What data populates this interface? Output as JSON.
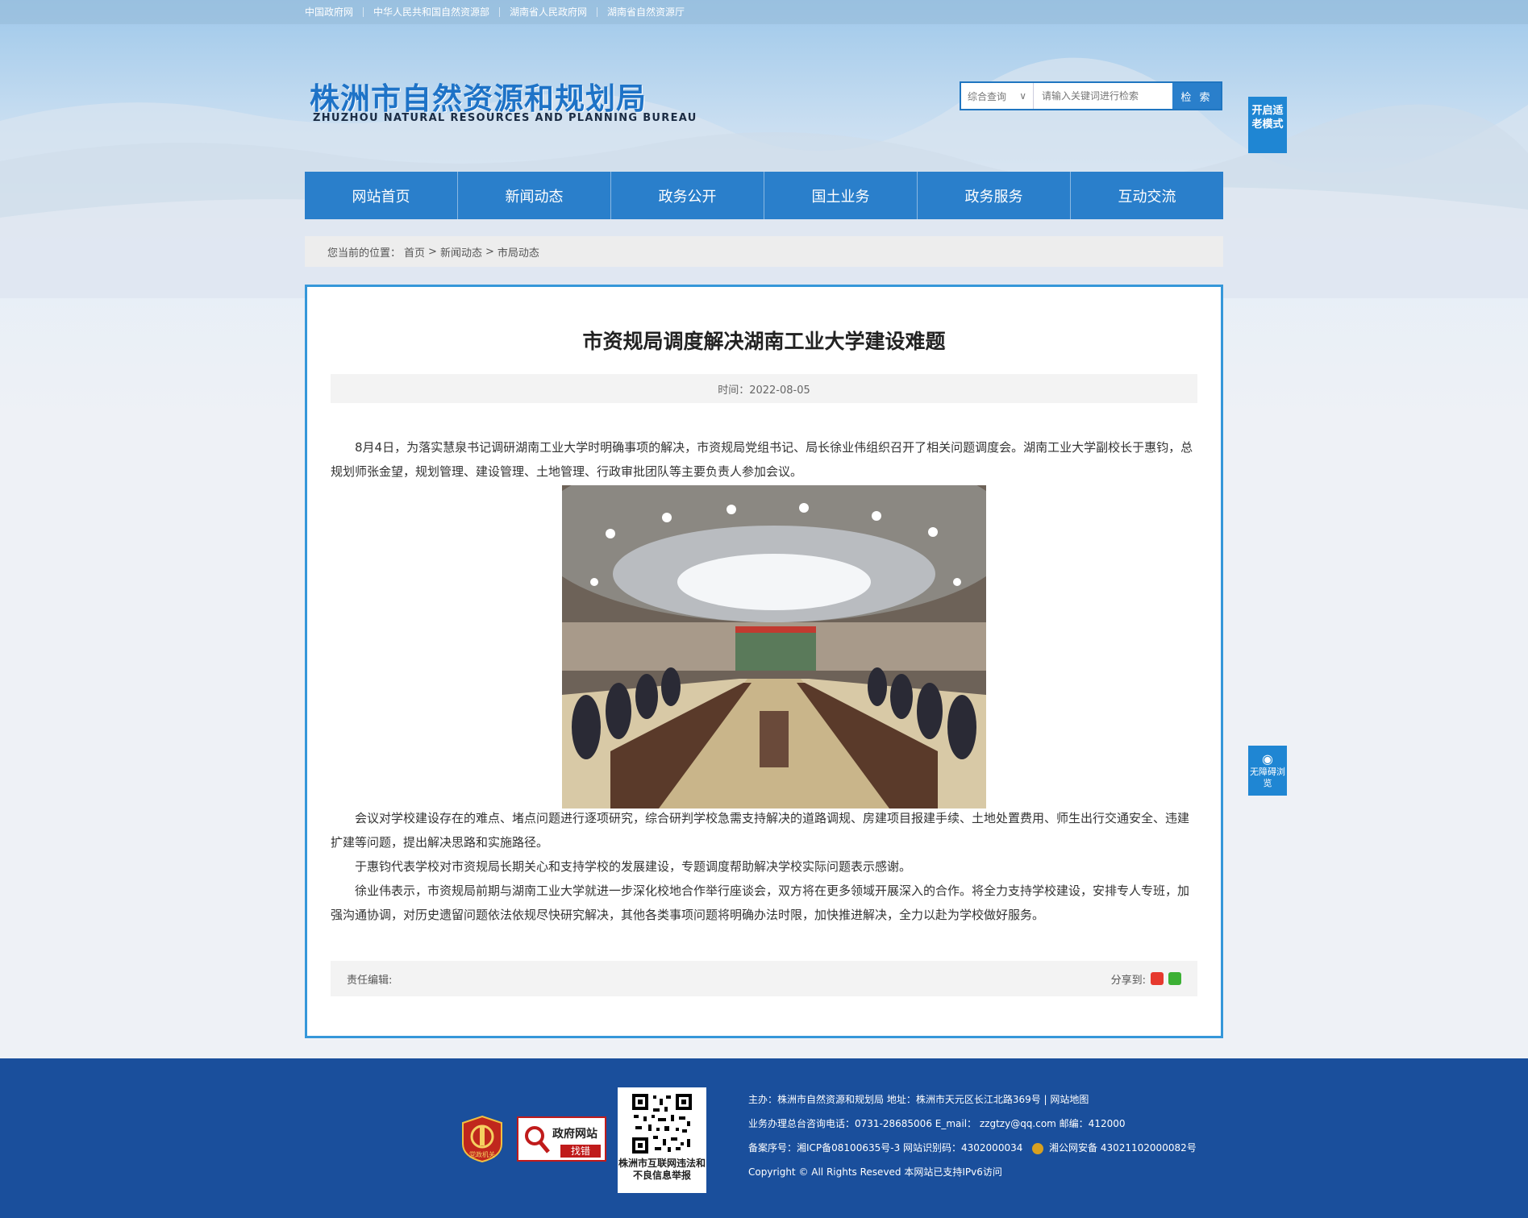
{
  "top_links": [
    "中国政府网",
    "中华人民共和国自然资源部",
    "湖南省人民政府网",
    "湖南省自然资源厅"
  ],
  "header": {
    "logo_cn": "株洲市自然资源和规划局",
    "logo_en": "ZHUZHOU NATURAL RESOURCES AND PLANNING BUREAU"
  },
  "search": {
    "scope": "综合查询",
    "placeholder": "请输入关键词进行检索",
    "button": "检 索"
  },
  "side": {
    "elder_mode": "开启适老模式",
    "accessibility": "无障碍浏览"
  },
  "nav": [
    "网站首页",
    "新闻动态",
    "政务公开",
    "国土业务",
    "政务服务",
    "互动交流"
  ],
  "breadcrumb": {
    "label": "您当前的位置：",
    "items": [
      "首页",
      ">",
      "新闻动态",
      ">",
      "市局动态"
    ]
  },
  "article": {
    "title": "市资规局调度解决湖南工业大学建设难题",
    "date": "时间：2022-08-05",
    "paragraphs": [
      "8月4日，为落实慧泉书记调研湖南工业大学时明确事项的解决，市资规局党组书记、局长徐业伟组织召开了相关问题调度会。湖南工业大学副校长于惠钧，总规划师张金望，规划管理、建设管理、土地管理、行政审批团队等主要负责人参加会议。",
      "会议对学校建设存在的难点、堵点问题进行逐项研究，综合研判学校急需支持解决的道路调规、房建项目报建手续、土地处置费用、师生出行交通安全、违建扩建等问题，提出解决思路和实施路径。",
      "于惠钧代表学校对市资规局长期关心和支持学校的发展建设，专题调度帮助解决学校实际问题表示感谢。",
      "徐业伟表示，市资规局前期与湖南工业大学就进一步深化校地合作举行座谈会，双方将在更多领域开展深入的合作。将全力支持学校建设，安排专人专班，加强沟通协调，对历史遗留问题依法依规尽快研究解决，其他各类事项问题将明确办法时限，加快推进解决，全力以赴为学校做好服务。"
    ],
    "editor": "责任编辑:",
    "share": "分享到:"
  },
  "footer": {
    "badge_party": "党政机关",
    "badge_error_title": "政府网站",
    "badge_error_sub": "找错",
    "qr_caption": "株洲市互联网违法和不良信息举报",
    "line1": "主办：株洲市自然资源和规划局   地址：株洲市天元区长江北路369号  |  网站地图",
    "line2": "业务办理总台咨询电话：0731-28685006    E_mail：   zzgtzy@qq.com     邮编：412000",
    "line3a": "备案序号：湘ICP备08100635号-3 网站识别码：4302000034",
    "line3b": "湘公网安备 43021102000082号",
    "line4": "Copyright © All Rights Reseved 本网站已支持IPv6访问"
  }
}
